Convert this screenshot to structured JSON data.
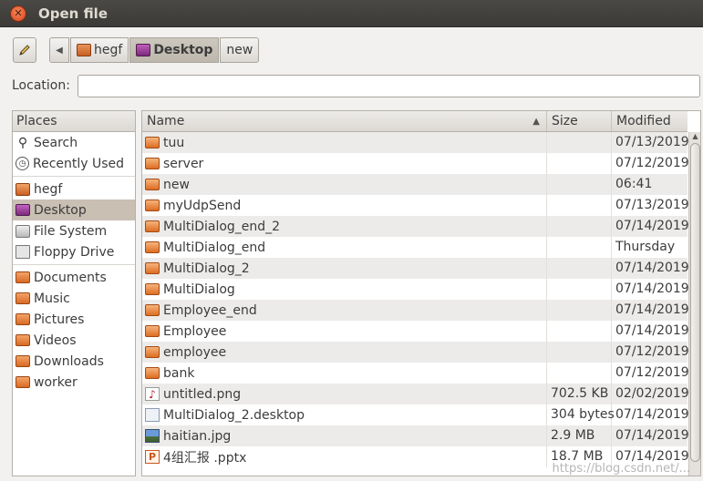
{
  "window": {
    "title": "Open file"
  },
  "path": {
    "crumbs": [
      {
        "label": "hegf",
        "icon": "home-folder-icon"
      },
      {
        "label": "Desktop",
        "icon": "desktop-icon",
        "active": true
      },
      {
        "label": "new"
      }
    ]
  },
  "location": {
    "label": "Location:",
    "value": ""
  },
  "places": {
    "header": "Places",
    "groups": [
      [
        {
          "label": "Search",
          "icon": "search-icon"
        },
        {
          "label": "Recently Used",
          "icon": "recent-icon"
        }
      ],
      [
        {
          "label": "hegf",
          "icon": "home-folder-icon"
        },
        {
          "label": "Desktop",
          "icon": "desktop-icon",
          "selected": true
        },
        {
          "label": "File System",
          "icon": "disk-icon"
        },
        {
          "label": "Floppy Drive",
          "icon": "floppy-icon"
        }
      ],
      [
        {
          "label": "Documents",
          "icon": "folder-icon"
        },
        {
          "label": "Music",
          "icon": "folder-icon"
        },
        {
          "label": "Pictures",
          "icon": "folder-icon"
        },
        {
          "label": "Videos",
          "icon": "folder-icon"
        },
        {
          "label": "Downloads",
          "icon": "folder-icon"
        },
        {
          "label": "worker",
          "icon": "folder-icon"
        }
      ]
    ]
  },
  "files": {
    "columns": {
      "name": "Name",
      "size": "Size",
      "modified": "Modified"
    },
    "rows": [
      {
        "name": "tuu",
        "size": "",
        "modified": "07/13/2019",
        "type": "folder"
      },
      {
        "name": "server",
        "size": "",
        "modified": "07/12/2019",
        "type": "folder"
      },
      {
        "name": "new",
        "size": "",
        "modified": "06:41",
        "type": "folder"
      },
      {
        "name": "myUdpSend",
        "size": "",
        "modified": "07/13/2019",
        "type": "folder"
      },
      {
        "name": "MultiDialog_end_2",
        "size": "",
        "modified": "07/14/2019",
        "type": "folder"
      },
      {
        "name": "MultiDialog_end",
        "size": "",
        "modified": "Thursday",
        "type": "folder"
      },
      {
        "name": "MultiDialog_2",
        "size": "",
        "modified": "07/14/2019",
        "type": "folder"
      },
      {
        "name": "MultiDialog",
        "size": "",
        "modified": "07/14/2019",
        "type": "folder"
      },
      {
        "name": "Employee_end",
        "size": "",
        "modified": "07/14/2019",
        "type": "folder"
      },
      {
        "name": "Employee",
        "size": "",
        "modified": "07/14/2019",
        "type": "folder"
      },
      {
        "name": "employee",
        "size": "",
        "modified": "07/12/2019",
        "type": "folder"
      },
      {
        "name": "bank",
        "size": "",
        "modified": "07/12/2019",
        "type": "folder"
      },
      {
        "name": "untitled.png",
        "size": "702.5 KB",
        "modified": "02/02/2019",
        "type": "image"
      },
      {
        "name": "MultiDialog_2.desktop",
        "size": "304 bytes",
        "modified": "07/14/2019",
        "type": "desktop"
      },
      {
        "name": "haitian.jpg",
        "size": "2.9 MB",
        "modified": "07/14/2019",
        "type": "photo"
      },
      {
        "name": "4组汇报 .pptx",
        "size": "18.7 MB",
        "modified": "07/14/2019",
        "type": "pptx"
      }
    ]
  },
  "watermark": "https://blog.csdn.net/..."
}
